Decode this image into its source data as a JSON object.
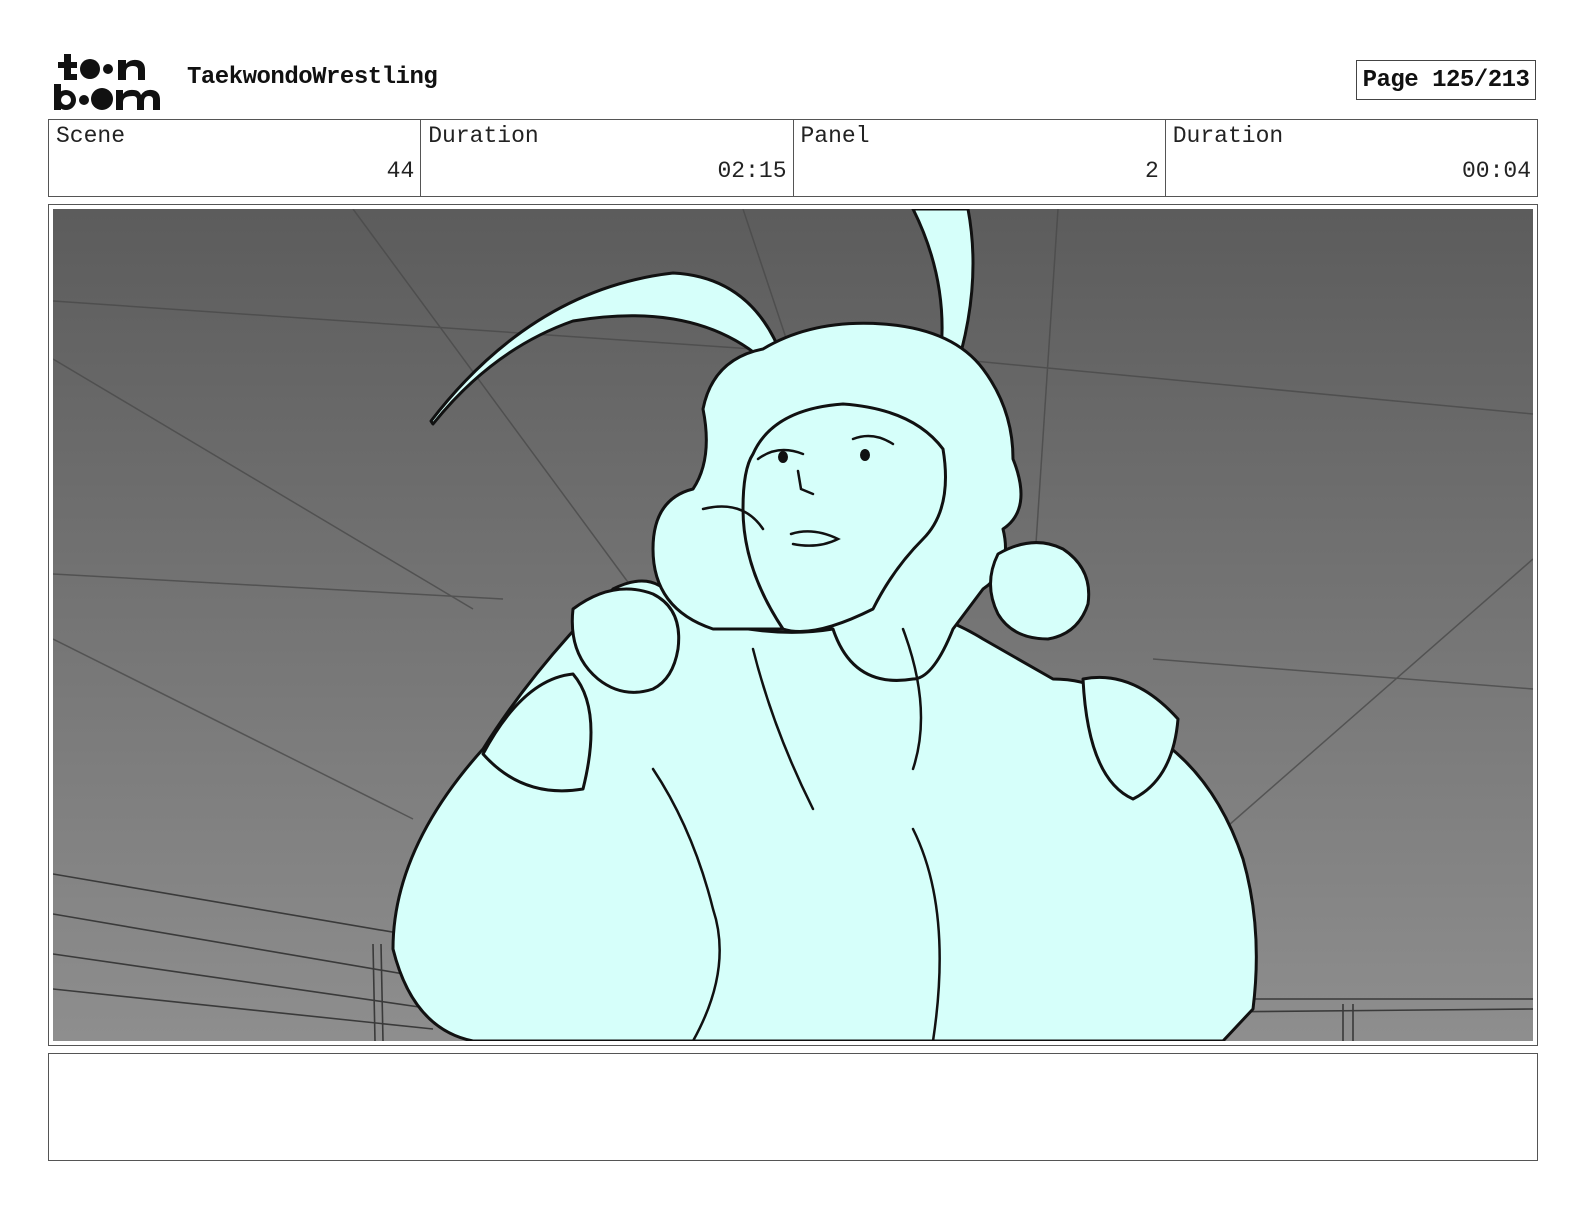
{
  "header": {
    "logo_label": "toon boom",
    "project_title": "TaekwondoWrestling",
    "page_indicator": "Page 125/213"
  },
  "info": [
    {
      "label": "Scene",
      "value": "44"
    },
    {
      "label": "Duration",
      "value": "02:15"
    },
    {
      "label": "Panel",
      "value": "2"
    },
    {
      "label": "Duration",
      "value": "00:04"
    }
  ],
  "panel": {
    "description_icon": "character-sketch",
    "fill_color": "#d6fffa",
    "background_top": "#5c5c5c",
    "background_bottom": "#8e8e8e"
  },
  "notes": {
    "text": ""
  }
}
